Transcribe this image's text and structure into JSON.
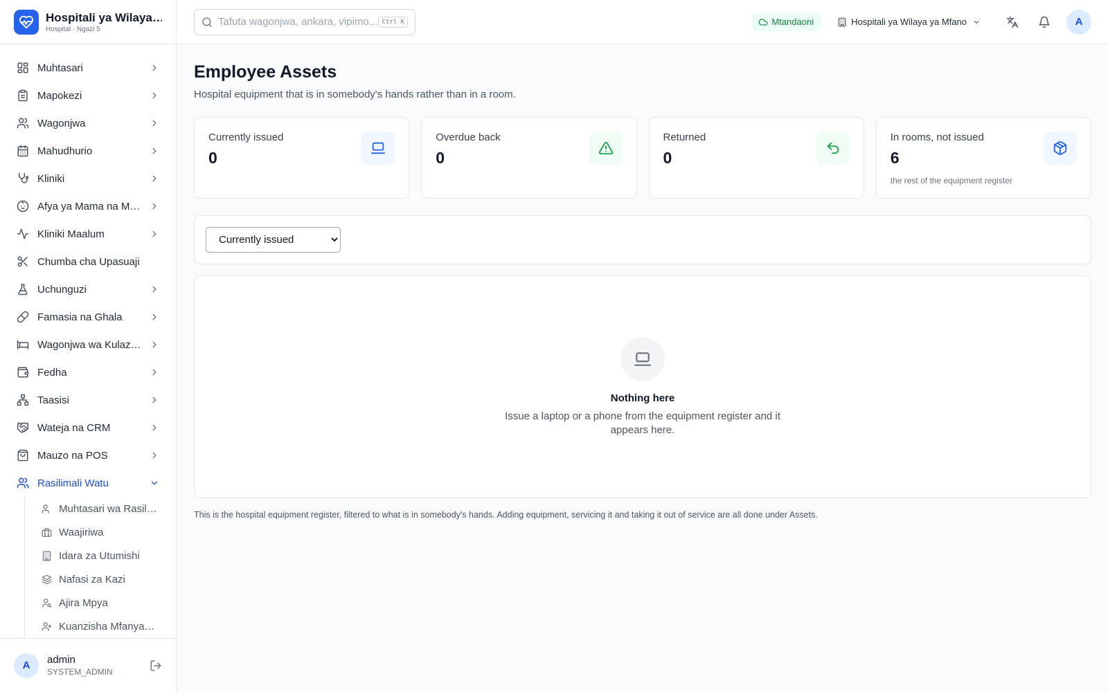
{
  "brand": {
    "name": "Hospitali ya Wilaya ya Mfano",
    "sub": "Hospital · Ngazi 5"
  },
  "sidebar": {
    "items": [
      {
        "label": "Muhtasari",
        "icon": "dashboard-icon"
      },
      {
        "label": "Mapokezi",
        "icon": "clipboard-icon"
      },
      {
        "label": "Wagonjwa",
        "icon": "users-icon"
      },
      {
        "label": "Mahudhurio",
        "icon": "calendar-icon"
      },
      {
        "label": "Kliniki",
        "icon": "stethoscope-icon"
      },
      {
        "label": "Afya ya Mama na Mtoto",
        "icon": "baby-icon"
      },
      {
        "label": "Kliniki Maalum",
        "icon": "activity-icon"
      },
      {
        "label": "Chumba cha Upasuaji",
        "icon": "scissors-icon"
      },
      {
        "label": "Uchunguzi",
        "icon": "flask-icon"
      },
      {
        "label": "Famasia na Ghala",
        "icon": "pill-icon"
      },
      {
        "label": "Wagonjwa wa Kulazwa",
        "icon": "bed-icon"
      },
      {
        "label": "Fedha",
        "icon": "wallet-icon"
      },
      {
        "label": "Taasisi",
        "icon": "network-icon"
      },
      {
        "label": "Wateja na CRM",
        "icon": "handshake-icon"
      },
      {
        "label": "Mauzo na POS",
        "icon": "shopping-bag-icon"
      },
      {
        "label": "Rasilimali Watu",
        "icon": "users-icon"
      }
    ],
    "sub_items": [
      {
        "label": "Muhtasari wa Rasilimali Watu",
        "icon": "users-icon"
      },
      {
        "label": "Waajiriwa",
        "icon": "briefcase-icon"
      },
      {
        "label": "Idara za Utumishi",
        "icon": "building-icon"
      },
      {
        "label": "Nafasi za Kazi",
        "icon": "layers-icon"
      },
      {
        "label": "Ajira Mpya",
        "icon": "user-key-icon"
      },
      {
        "label": "Kuanzisha Mfanyakazi",
        "icon": "user-plus-icon"
      }
    ]
  },
  "user": {
    "initial": "A",
    "name": "admin",
    "role": "SYSTEM_ADMIN"
  },
  "topbar": {
    "search_placeholder": "Tafuta wagonjwa, ankara, vipimo...",
    "shortcut": "Ctrl K",
    "status": "Mtandaoni",
    "facility": "Hospitali ya Wilaya ya Mfano",
    "avatar_initial": "A"
  },
  "page": {
    "title": "Employee Assets",
    "subtitle": "Hospital equipment that is in somebody's hands rather than in a room."
  },
  "stats": [
    {
      "label": "Currently issued",
      "value": "0",
      "note": "",
      "icon": "laptop-icon",
      "color": "#2563eb",
      "bg": "#eff6ff"
    },
    {
      "label": "Overdue back",
      "value": "0",
      "note": "",
      "icon": "warning-icon",
      "color": "#16a34a",
      "bg": "#f0fdf4"
    },
    {
      "label": "Returned",
      "value": "0",
      "note": "",
      "icon": "undo-icon",
      "color": "#16a34a",
      "bg": "#f0fdf4"
    },
    {
      "label": "In rooms, not issued",
      "value": "6",
      "note": "the rest of the equipment register",
      "icon": "package-icon",
      "color": "#2563eb",
      "bg": "#eff6ff"
    }
  ],
  "filter": {
    "selected": "Currently issued"
  },
  "empty": {
    "title": "Nothing here",
    "description": "Issue a laptop or a phone from the equipment register and it appears here."
  },
  "footnote": "This is the hospital equipment register, filtered to what is in somebody's hands. Adding equipment, servicing it and taking it out of service are all done under Assets."
}
